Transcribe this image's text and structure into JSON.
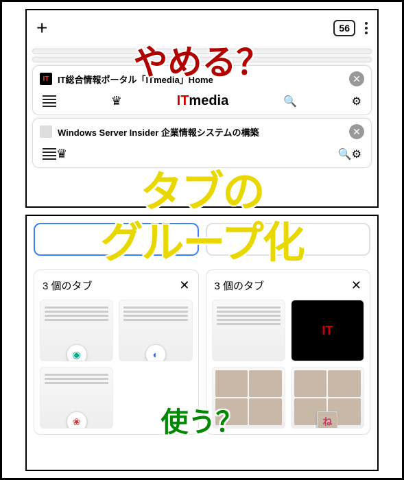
{
  "overlay": {
    "yameru": "やめる？",
    "tabuno": "タブの",
    "group": "グループ化",
    "tsukau": "使う？"
  },
  "toolbar": {
    "tab_count": "56"
  },
  "tabs": [
    {
      "title": "IT総合情報ポータル「ITmedia」Home",
      "favicon_text": "IT",
      "logo_prefix": "IT",
      "logo_suffix": "media"
    },
    {
      "title": "Windows Server Insider 企業情報システムの構築",
      "favicon_text": ""
    }
  ],
  "groups": [
    {
      "title": "3 個のタブ"
    },
    {
      "title": "3 個のタブ"
    }
  ],
  "thumbs": {
    "g1t1_badge": "◉",
    "g1t2_badge": "◐",
    "g1t3_badge": "❀",
    "g2t2_itlogo": "IT",
    "g2t4_badge": "ね"
  }
}
